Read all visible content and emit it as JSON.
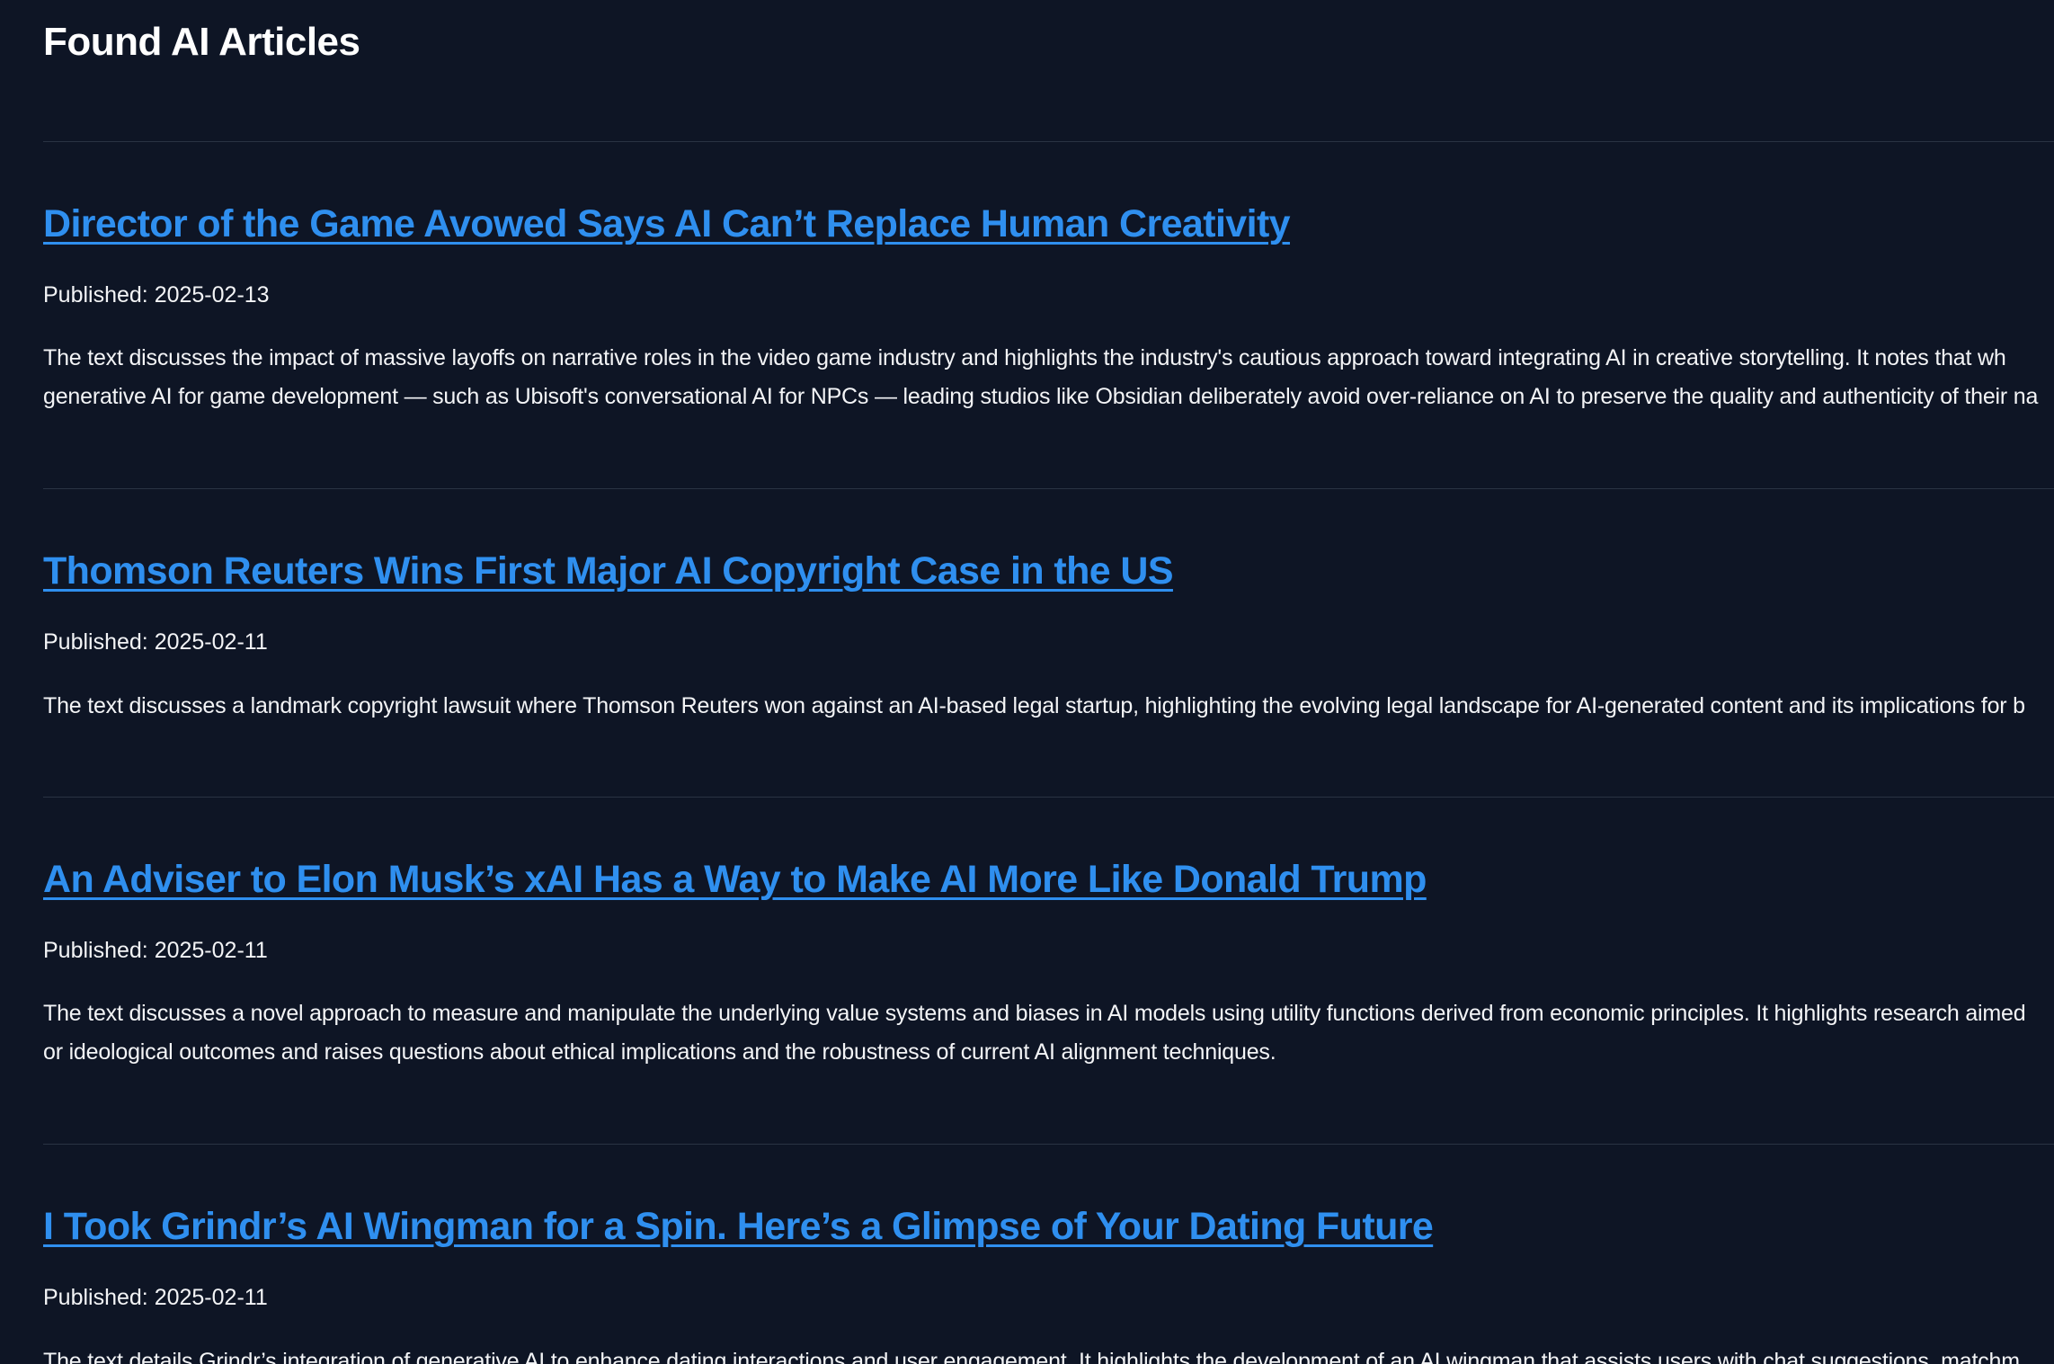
{
  "page": {
    "title": "Found AI Articles"
  },
  "articles": [
    {
      "title": "Director of the Game Avowed Says AI Can’t Replace Human Creativity",
      "published": "Published: 2025-02-13",
      "summary_line1": "The text discusses the impact of massive layoffs on narrative roles in the video game industry and highlights the industry's cautious approach toward integrating AI in creative storytelling. It notes that wh",
      "summary_line2": "generative AI for game development — such as Ubisoft's conversational AI for NPCs — leading studios like Obsidian deliberately avoid over-reliance on AI to preserve the quality and authenticity of their na"
    },
    {
      "title": "Thomson Reuters Wins First Major AI Copyright Case in the US",
      "published": "Published: 2025-02-11",
      "summary_line1": "The text discusses a landmark copyright lawsuit where Thomson Reuters won against an AI-based legal startup, highlighting the evolving legal landscape for AI-generated content and its implications for b",
      "summary_line2": ""
    },
    {
      "title": "An Adviser to Elon Musk’s xAI Has a Way to Make AI More Like Donald Trump",
      "published": "Published: 2025-02-11",
      "summary_line1": "The text discusses a novel approach to measure and manipulate the underlying value systems and biases in AI models using utility functions derived from economic principles. It highlights research aimed",
      "summary_line2": "or ideological outcomes and raises questions about ethical implications and the robustness of current AI alignment techniques."
    },
    {
      "title": "I Took Grindr’s AI Wingman for a Spin. Here’s a Glimpse of Your Dating Future",
      "published": "Published: 2025-02-11",
      "summary_line1": "The text details Grindr’s integration of generative AI to enhance dating interactions and user engagement. It highlights the development of an AI wingman that assists users with chat suggestions, matchm",
      "summary_line2": ""
    }
  ]
}
